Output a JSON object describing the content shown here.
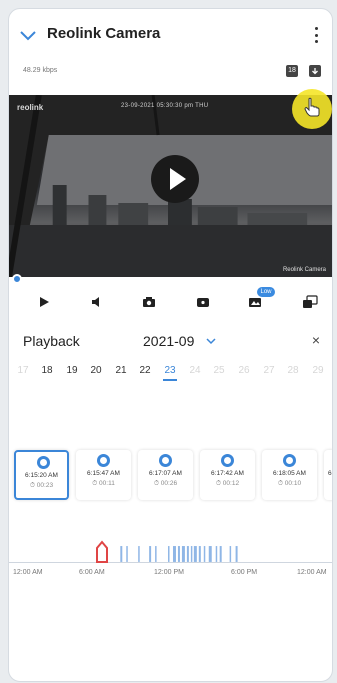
{
  "header": {
    "title": "Reolink Camera",
    "bitrate": "48.29 kbps",
    "calendar_badge": "18"
  },
  "video": {
    "watermark_logo": "reolink",
    "timestamp": "23-09-2021 05:30:30 pm THU",
    "camera_label": "Reolink Camera"
  },
  "controls": {
    "low_badge": "Low"
  },
  "playback": {
    "label": "Playback",
    "month": "2021-09",
    "close_label": "×"
  },
  "days": [
    "17",
    "18",
    "19",
    "20",
    "21",
    "22",
    "23",
    "24",
    "25",
    "26",
    "27",
    "28",
    "29"
  ],
  "selected_day": "23",
  "clips": [
    {
      "time": "6:15:20 AM",
      "duration": "00:23",
      "active": true
    },
    {
      "time": "6:15:47 AM",
      "duration": "00:11",
      "active": false
    },
    {
      "time": "6:17:07 AM",
      "duration": "00:26",
      "active": false
    },
    {
      "time": "6:17:42 AM",
      "duration": "00:12",
      "active": false
    },
    {
      "time": "6:18:05 AM",
      "duration": "00:10",
      "active": false
    },
    {
      "time": "6",
      "duration": "",
      "active": false
    }
  ],
  "timeline_labels": [
    "12:00 AM",
    "6:00 AM",
    "12:00 PM",
    "6:00 PM",
    "12:00 AM"
  ],
  "colors": {
    "accent": "#3b86d8",
    "highlight_cursor": "#f5e628"
  }
}
